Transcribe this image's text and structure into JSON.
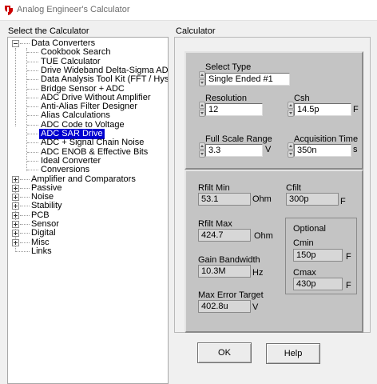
{
  "window": {
    "title": "Analog Engineer's Calculator"
  },
  "left_panel": {
    "header": "Select the Calculator"
  },
  "right_panel": {
    "header": "Calculator"
  },
  "tree": {
    "items": [
      {
        "label": "Data Converters",
        "level": 0,
        "expander": "minus"
      },
      {
        "label": "Cookbook Search",
        "level": 1
      },
      {
        "label": "TUE Calculator",
        "level": 1
      },
      {
        "label": "Drive Wideband Delta-Sigma ADC",
        "level": 1
      },
      {
        "label": "Data Analysis Tool Kit (FFT / Hyst)",
        "level": 1
      },
      {
        "label": "Bridge Sensor + ADC",
        "level": 1
      },
      {
        "label": "ADC Drive Without Amplifier",
        "level": 1
      },
      {
        "label": "Anti-Alias Filter Designer",
        "level": 1
      },
      {
        "label": "Alias Calculations",
        "level": 1
      },
      {
        "label": "ADC Code to Voltage",
        "level": 1
      },
      {
        "label": "ADC SAR Drive",
        "level": 1,
        "selected": true
      },
      {
        "label": "ADC + Signal Chain Noise",
        "level": 1
      },
      {
        "label": "ADC ENOB & Effective Bits",
        "level": 1
      },
      {
        "label": "Ideal Converter",
        "level": 1
      },
      {
        "label": "Conversions",
        "level": 1
      },
      {
        "label": "Amplifier and Comparators",
        "level": 0,
        "expander": "plus"
      },
      {
        "label": "Passive",
        "level": 0,
        "expander": "plus"
      },
      {
        "label": "Noise",
        "level": 0,
        "expander": "plus"
      },
      {
        "label": "Stability",
        "level": 0,
        "expander": "plus"
      },
      {
        "label": "PCB",
        "level": 0,
        "expander": "plus"
      },
      {
        "label": "Sensor",
        "level": 0,
        "expander": "plus"
      },
      {
        "label": "Digital",
        "level": 0,
        "expander": "plus"
      },
      {
        "label": "Misc",
        "level": 0,
        "expander": "plus"
      },
      {
        "label": "Links",
        "level": 0
      }
    ]
  },
  "inputs": {
    "select_type": {
      "label": "Select Type",
      "value": "Single Ended #1"
    },
    "resolution": {
      "label": "Resolution",
      "value": "12"
    },
    "csh": {
      "label": "Csh",
      "value": "14.5p",
      "unit": "F"
    },
    "full_scale_range": {
      "label": "Full Scale Range",
      "value": "3.3",
      "unit": "V"
    },
    "acquisition_time": {
      "label": "Acquisition Time",
      "value": "350n",
      "unit": "s"
    }
  },
  "outputs": {
    "rfilt_min": {
      "label": "Rfilt Min",
      "value": "53.1",
      "unit": "Ohm"
    },
    "cfilt": {
      "label": "Cfilt",
      "value": "300p",
      "unit": "F"
    },
    "rfilt_max": {
      "label": "Rfilt Max",
      "value": "424.7",
      "unit": "Ohm"
    },
    "gain_bandwidth": {
      "label": "Gain Bandwidth",
      "value": "10.3M",
      "unit": "Hz"
    },
    "max_error_target": {
      "label": "Max Error Target",
      "value": "402.8u",
      "unit": "V"
    },
    "optional": {
      "title": "Optional",
      "cmin": {
        "label": "Cmin",
        "value": "150p",
        "unit": "F"
      },
      "cmax": {
        "label": "Cmax",
        "value": "430p",
        "unit": "F"
      }
    }
  },
  "buttons": {
    "ok": "OK",
    "help": "Help"
  },
  "colors": {
    "selection": "#0000d0",
    "panel": "#c4c4c4",
    "ti_logo": "#cc0000"
  }
}
